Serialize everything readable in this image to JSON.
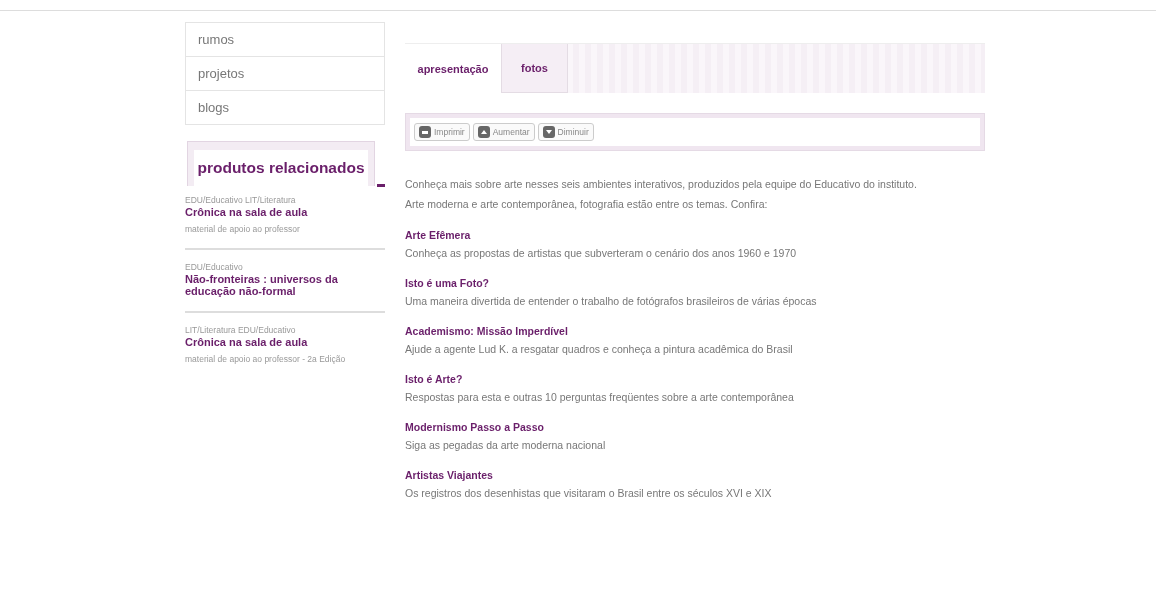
{
  "nav": [
    {
      "label": "rumos"
    },
    {
      "label": "projetos"
    },
    {
      "label": "blogs"
    }
  ],
  "related": {
    "title": "produtos relacionados",
    "items": [
      {
        "tags": "EDU/Educativo LIT/Literatura",
        "title": "Crônica na sala de aula",
        "subtitle": "material de apoio ao professor"
      },
      {
        "tags": "EDU/Educativo",
        "title": "Não-fronteiras : universos da educação não-formal"
      },
      {
        "tags": "LIT/Literatura EDU/Educativo",
        "title": "Crônica na sala de aula",
        "subtitle": "material de apoio ao professor - 2a Edição"
      }
    ]
  },
  "tabs": [
    {
      "label": "apresentação",
      "selected": true
    },
    {
      "label": "fotos",
      "selected": false
    }
  ],
  "toolbar": [
    {
      "label": "Imprimir",
      "kind": "print"
    },
    {
      "label": "Aumentar",
      "kind": "increase"
    },
    {
      "label": "Diminuir",
      "kind": "decrease"
    }
  ],
  "intro": [
    "Conheça mais sobre arte nesses seis ambientes interativos, produzidos pela equipe do Educativo do instituto.",
    "Arte moderna e arte contemporânea, fotografia estão entre os temas. Confira:"
  ],
  "items": [
    {
      "title": "Arte Efêmera",
      "text": "Conheça as propostas de artistas que subverteram o cenário dos anos 1960 e 1970"
    },
    {
      "title": "Isto é uma Foto?",
      "text": "Uma maneira divertida de entender o trabalho de fotógrafos brasileiros de várias épocas"
    },
    {
      "title": "Academismo: Missão Imperdível",
      "text": "Ajude a agente Lud K. a resgatar quadros e conheça a pintura acadêmica do Brasil"
    },
    {
      "title": "Isto é Arte?",
      "text": "Respostas para esta e outras 10 perguntas freqüentes sobre a arte contemporânea"
    },
    {
      "title": "Modernismo Passo a Passo",
      "text": "Siga as pegadas da arte moderna nacional"
    },
    {
      "title": "Artistas Viajantes",
      "text": "Os registros dos desenhistas que visitaram o Brasil entre os séculos XVI e XIX"
    }
  ]
}
